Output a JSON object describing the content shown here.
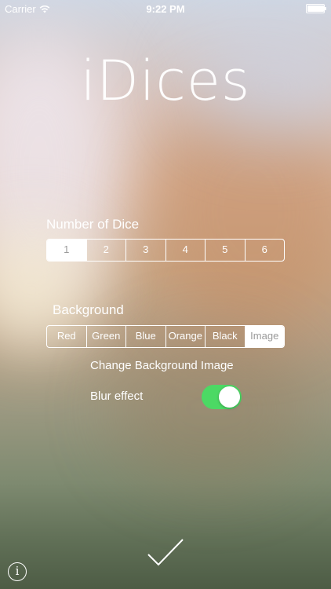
{
  "status_bar": {
    "carrier": "Carrier",
    "time": "9:22 PM",
    "battery_level": 1.0
  },
  "app_title": "iDices",
  "number_of_dice": {
    "label": "Number of Dice",
    "options": [
      "1",
      "2",
      "3",
      "4",
      "5",
      "6"
    ],
    "selected": "1"
  },
  "background": {
    "label": "Background",
    "options": [
      "Red",
      "Green",
      "Blue",
      "Orange",
      "Black",
      "Image"
    ],
    "selected": "Image"
  },
  "change_background_label": "Change Background Image",
  "blur_effect": {
    "label": "Blur effect",
    "enabled": true
  },
  "icons": {
    "wifi": "wifi-icon",
    "battery": "battery-icon",
    "done": "checkmark-icon",
    "info": "info-icon",
    "info_glyph": "i"
  },
  "colors": {
    "toggle_on": "#4cd964",
    "selected_segment_text": "#9a9a9a"
  }
}
